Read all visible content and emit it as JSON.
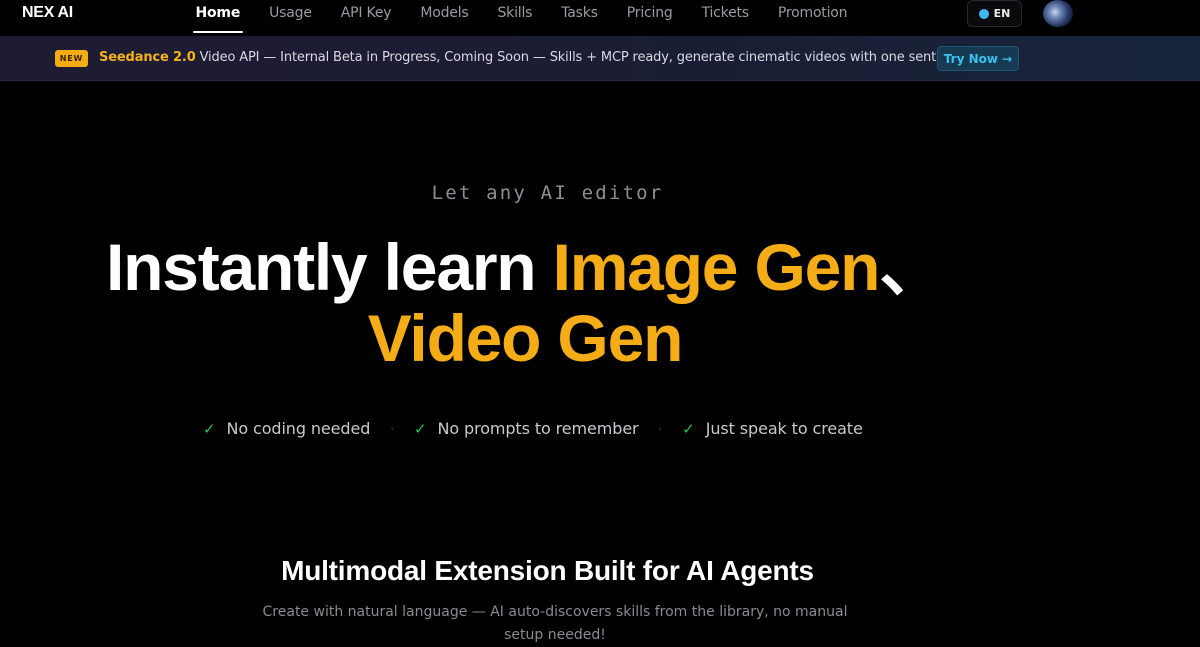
{
  "nav": {
    "logo": "NEX AI",
    "links": [
      {
        "label": "Home",
        "active": true
      },
      {
        "label": "Usage"
      },
      {
        "label": "API Key"
      },
      {
        "label": "Models"
      },
      {
        "label": "Skills"
      },
      {
        "label": "Tasks"
      },
      {
        "label": "Pricing"
      },
      {
        "label": "Tickets"
      },
      {
        "label": "Promotion"
      }
    ],
    "language": "EN"
  },
  "banner": {
    "badge": "NEW",
    "highlight": "Seedance 2.0",
    "text": " Video API — Internal Beta in Progress, Coming Soon — Skills + MCP ready, generate cinematic videos with one sentence",
    "cta": "Try Now →"
  },
  "hero": {
    "eyebrow": "Let any AI editor",
    "line1_white": "Instantly learn ",
    "line1_accent": "Image Gen",
    "line1_tail": "、",
    "line2": "Video Gen",
    "features": [
      "No coding needed",
      "No prompts to remember",
      "Just speak to create"
    ],
    "separator": "·",
    "check": "✓"
  },
  "section": {
    "title": "Multimodal Extension Built for AI Agents",
    "description": "Create with natural language — AI auto-discovers skills from the library, no manual setup needed!"
  },
  "colors": {
    "accent": "#f5ad17",
    "link_blue": "#3cc0ef",
    "check_green": "#27c05f",
    "background": "#000000"
  }
}
